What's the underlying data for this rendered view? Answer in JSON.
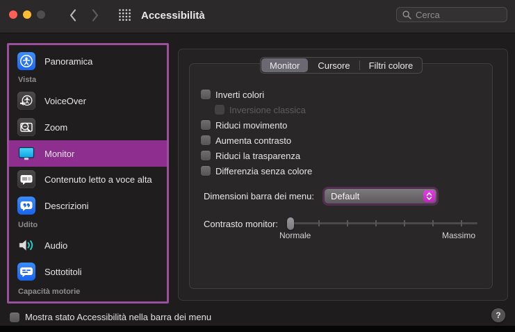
{
  "titlebar": {
    "title": "Accessibilità",
    "search_placeholder": "Cerca"
  },
  "sidebar": {
    "items": [
      {
        "type": "item",
        "icon": "accessibility-overview-icon",
        "label": "Panoramica",
        "selected": false
      },
      {
        "type": "header",
        "label": "Vista"
      },
      {
        "type": "item",
        "icon": "voiceover-icon",
        "label": "VoiceOver",
        "selected": false
      },
      {
        "type": "item",
        "icon": "zoom-icon",
        "label": "Zoom",
        "selected": false
      },
      {
        "type": "item",
        "icon": "monitor-icon",
        "label": "Monitor",
        "selected": true
      },
      {
        "type": "item",
        "icon": "spoken-content-icon",
        "label": "Contenuto letto a voce alta",
        "selected": false
      },
      {
        "type": "item",
        "icon": "descriptions-icon",
        "label": "Descrizioni",
        "selected": false
      },
      {
        "type": "header",
        "label": "Udito"
      },
      {
        "type": "item",
        "icon": "audio-icon",
        "label": "Audio",
        "selected": false
      },
      {
        "type": "item",
        "icon": "captions-icon",
        "label": "Sottotitoli",
        "selected": false
      },
      {
        "type": "header",
        "label": "Capacità motorie"
      }
    ]
  },
  "tabs": [
    {
      "label": "Monitor",
      "selected": true
    },
    {
      "label": "Cursore",
      "selected": false
    },
    {
      "label": "Filtri colore",
      "selected": false
    }
  ],
  "monitor_panel": {
    "checkboxes": [
      {
        "label": "Inverti colori",
        "checked": false,
        "disabled": false,
        "indent": false
      },
      {
        "label": "Inversione classica",
        "checked": false,
        "disabled": true,
        "indent": true
      },
      {
        "label": "Riduci movimento",
        "checked": false,
        "disabled": false,
        "indent": false
      },
      {
        "label": "Aumenta contrasto",
        "checked": false,
        "disabled": false,
        "indent": false
      },
      {
        "label": "Riduci la trasparenza",
        "checked": false,
        "disabled": false,
        "indent": false
      },
      {
        "label": "Differenzia senza colore",
        "checked": false,
        "disabled": false,
        "indent": false
      }
    ],
    "menu_size": {
      "label": "Dimensioni barra dei menu:",
      "value": "Default"
    },
    "contrast": {
      "label": "Contrasto monitor:",
      "min_label": "Normale",
      "max_label": "Massimo",
      "value": 0,
      "tick_count": 7
    }
  },
  "footer": {
    "label": "Mostra stato Accessibilità nella barra dei menu",
    "checked": false,
    "help_glyph": "?"
  },
  "colors": {
    "selection_magenta": "#8e2f90",
    "focus_ring": "#9b4f9c",
    "stepper_magenta": "#d232d3",
    "overview_blue": "#2d7bf6"
  }
}
